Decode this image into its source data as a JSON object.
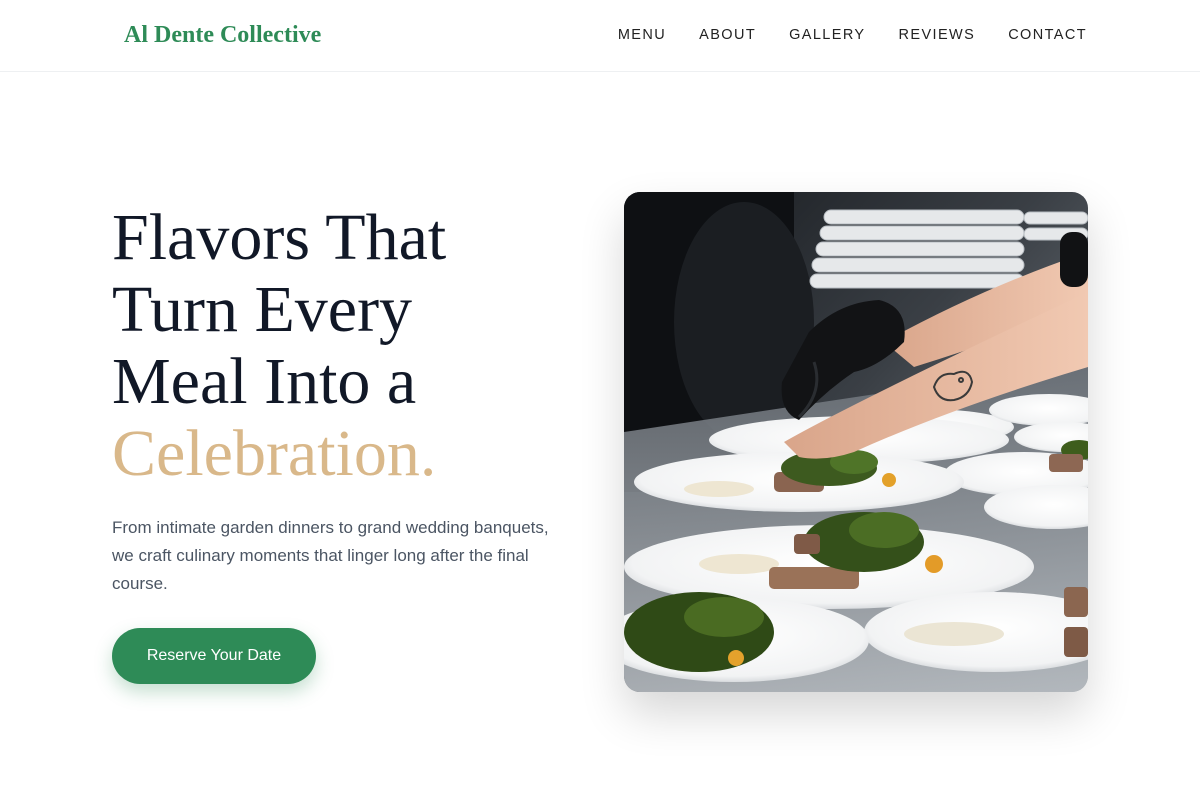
{
  "header": {
    "logo": "Al Dente Collective",
    "nav": [
      "MENU",
      "ABOUT",
      "GALLERY",
      "REVIEWS",
      "CONTACT"
    ]
  },
  "hero": {
    "headline_lines": [
      "Flavors That",
      "Turn Every",
      "Meal Into a"
    ],
    "headline_accent": "Celebration.",
    "subtext": "From intimate garden dinners to grand wedding banquets, we craft culinary moments that linger long after the final course.",
    "cta_label": "Reserve Your Date"
  },
  "colors": {
    "brand": "#2e8b57",
    "accent": "#d9b88a",
    "heading": "#111827",
    "body_text": "#4b5563"
  }
}
